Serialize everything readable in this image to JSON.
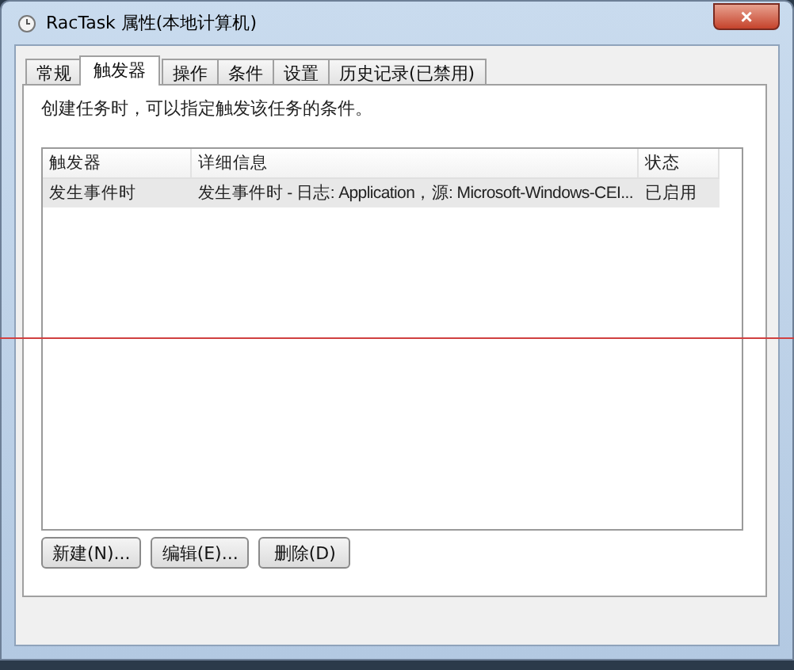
{
  "window": {
    "title": "RacTask 属性(本地计算机)",
    "close": "×"
  },
  "tabs": [
    {
      "label": "常规",
      "selected": false
    },
    {
      "label": "触发器",
      "selected": true
    },
    {
      "label": "操作",
      "selected": false
    },
    {
      "label": "条件",
      "selected": false
    },
    {
      "label": "设置",
      "selected": false
    },
    {
      "label": "历史记录(已禁用)",
      "selected": false
    }
  ],
  "description": "创建任务时，可以指定触发该任务的条件。",
  "table": {
    "columns": [
      "触发器",
      "详细信息",
      "状态"
    ],
    "rows": [
      {
        "selected": true,
        "cells": [
          "发生事件时",
          "发生事件时 - 日志: Application，源: Microsoft-Windows-CEI...",
          "已启用"
        ]
      }
    ]
  },
  "buttons": [
    "新建(N)...",
    "编辑(E)...",
    "删除(D)"
  ]
}
